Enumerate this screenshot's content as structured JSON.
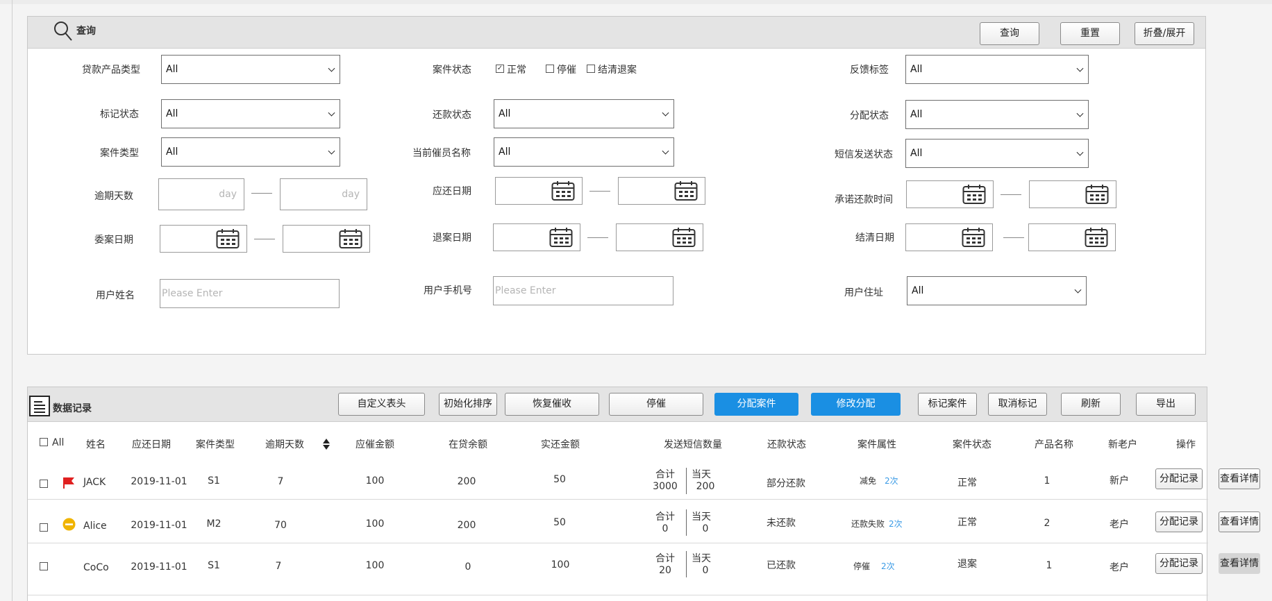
{
  "query": {
    "title": "查询",
    "buttons": {
      "search": "查询",
      "reset": "重置",
      "toggle": "折叠/展开"
    },
    "loan_product_type": {
      "label": "贷款产品类型",
      "value": "All"
    },
    "case_status": {
      "label": "案件状态",
      "options": [
        {
          "label": "正常",
          "checked": true
        },
        {
          "label": "停催",
          "checked": false
        },
        {
          "label": "结清退案",
          "checked": false
        }
      ]
    },
    "feedback_tag": {
      "label": "反馈标签",
      "value": "All"
    },
    "mark_status": {
      "label": "标记状态",
      "value": "All"
    },
    "repay_status": {
      "label": "还款状态",
      "value": "All"
    },
    "assign_status": {
      "label": "分配状态",
      "value": "All"
    },
    "case_type": {
      "label": "案件类型",
      "value": "All"
    },
    "collector_name": {
      "label": "当前催员名称",
      "value": "All"
    },
    "sms_status": {
      "label": "短信发送状态",
      "value": "All"
    },
    "overdue_days": {
      "label": "逾期天数",
      "placeholder": "day"
    },
    "due_date": {
      "label": "应还日期"
    },
    "promise_date": {
      "label": "承诺还款时间"
    },
    "entrust_date": {
      "label": "委案日期"
    },
    "withdraw_date": {
      "label": "退案日期"
    },
    "settle_date": {
      "label": "结清日期"
    },
    "user_name": {
      "label": "用户姓名",
      "placeholder": "Please Enter"
    },
    "user_phone": {
      "label": "用户手机号",
      "placeholder": "Please Enter"
    },
    "user_address": {
      "label": "用户住址",
      "value": "All"
    }
  },
  "records": {
    "title": "数据记录",
    "toolbar": [
      {
        "label": "自定义表头",
        "primary": false
      },
      {
        "label": "初始化排序",
        "primary": false
      },
      {
        "label": "恢复催收",
        "primary": false
      },
      {
        "label": "停催",
        "primary": false
      },
      {
        "label": "分配案件",
        "primary": true
      },
      {
        "label": "修改分配",
        "primary": true
      },
      {
        "label": "标记案件",
        "primary": false
      },
      {
        "label": "取消标记",
        "primary": false
      },
      {
        "label": "刷新",
        "primary": false
      },
      {
        "label": "导出",
        "primary": false
      }
    ],
    "headers": {
      "all": "All",
      "name": "姓名",
      "due_date": "应还日期",
      "case_type": "案件类型",
      "overdue_days": "逾期天数",
      "due_amount": "应催金额",
      "balance": "在贷余额",
      "repaid": "实还金额",
      "sms_count": "发送短信数量",
      "repay_status": "还款状态",
      "attr": "案件属性",
      "case_status": "案件状态",
      "product": "产品名称",
      "customer": "新老户",
      "ops": "操作"
    },
    "sms_labels": {
      "total": "合计",
      "today": "当天"
    },
    "actions": {
      "assign_log": "分配记录",
      "detail": "查看详情"
    },
    "rows": [
      {
        "name": "JACK",
        "marker": "red-flag",
        "due_date": "2019-11-01",
        "case_type": "S1",
        "overdue_days": "7",
        "due_amount": "100",
        "balance": "200",
        "repaid": "50",
        "sms_total": "3000",
        "sms_today": "200",
        "repay_status": "部分还款",
        "attr": "减免",
        "attr_count": "2次",
        "case_status": "正常",
        "product": "1",
        "customer": "新户"
      },
      {
        "name": "Alice",
        "marker": "yellow-minus",
        "due_date": "2019-11-01",
        "case_type": "M2",
        "overdue_days": "70",
        "due_amount": "100",
        "balance": "200",
        "repaid": "50",
        "sms_total": "0",
        "sms_today": "0",
        "repay_status": "未还款",
        "attr": "还款失败",
        "attr_count": "2次",
        "case_status": "正常",
        "product": "2",
        "customer": "老户"
      },
      {
        "name": "CoCo",
        "marker": "",
        "due_date": "2019-11-01",
        "case_type": "S1",
        "overdue_days": "7",
        "due_amount": "100",
        "balance": "0",
        "repaid": "100",
        "sms_total": "20",
        "sms_today": "0",
        "repay_status": "已还款",
        "attr": "停催",
        "attr_count": "2次",
        "case_status": "退案",
        "product": "1",
        "customer": "老户"
      }
    ],
    "colors": {
      "primary": "#1a8fe3",
      "link": "#3b9be6",
      "flag": "#e02020",
      "warn": "#f0b400"
    }
  }
}
